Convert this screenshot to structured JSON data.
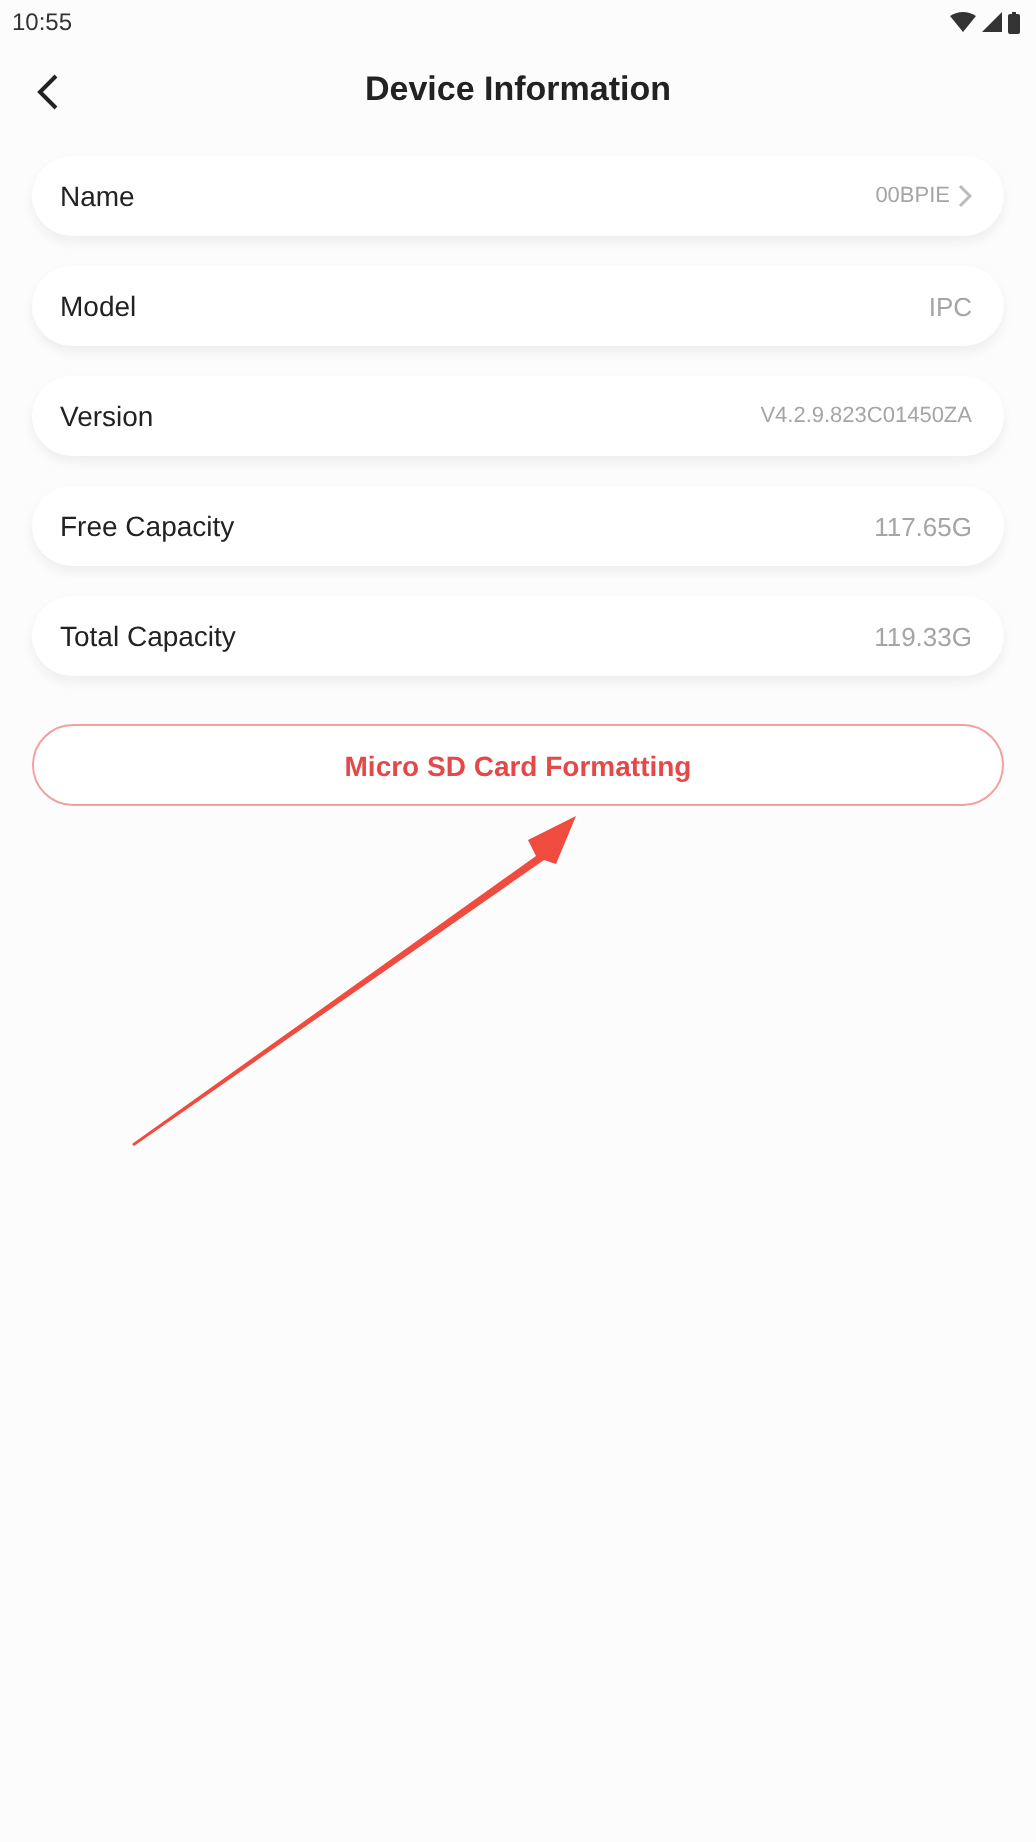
{
  "status_bar": {
    "time": "10:55"
  },
  "header": {
    "title": "Device Information"
  },
  "rows": [
    {
      "label": "Name",
      "value": "00BPIE",
      "chevron": true
    },
    {
      "label": "Model",
      "value": "IPC",
      "chevron": false
    },
    {
      "label": "Version",
      "value": "V4.2.9.823C01450ZA",
      "chevron": false
    },
    {
      "label": "Free Capacity",
      "value": "117.65G",
      "chevron": false
    },
    {
      "label": "Total Capacity",
      "value": "119.33G",
      "chevron": false
    }
  ],
  "format_button": {
    "label": "Micro SD Card Formatting"
  }
}
